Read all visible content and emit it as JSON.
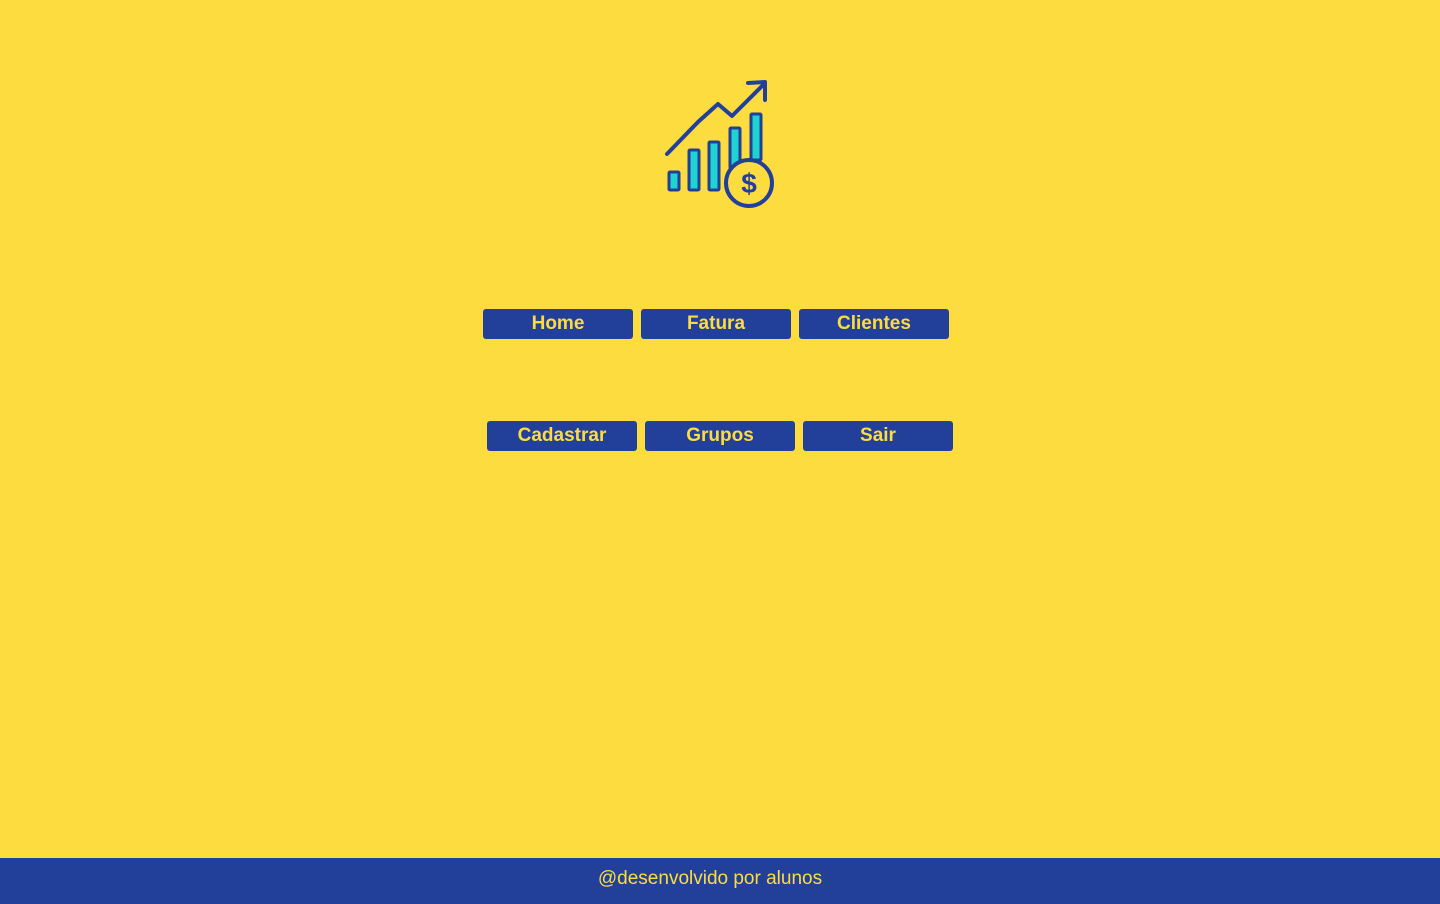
{
  "theme": {
    "background": "#FDDC40",
    "primary": "#22409A",
    "accent": "#1FD3D0"
  },
  "logo": {
    "icon": "growth-chart-dollar-icon"
  },
  "nav": {
    "row1": [
      {
        "label": "Home"
      },
      {
        "label": "Fatura"
      },
      {
        "label": "Clientes"
      }
    ],
    "row2": [
      {
        "label": "Cadastrar"
      },
      {
        "label": "Grupos"
      },
      {
        "label": "Sair"
      }
    ]
  },
  "footer": {
    "text": "@desenvolvido por alunos"
  }
}
